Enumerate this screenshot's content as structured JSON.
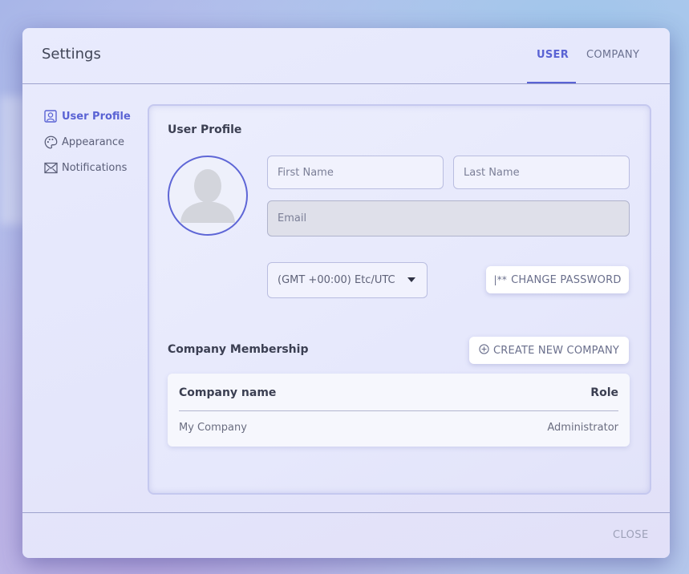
{
  "dialog": {
    "title": "Settings",
    "tabs": [
      {
        "label": "USER",
        "active": true
      },
      {
        "label": "COMPANY",
        "active": false
      }
    ],
    "close_label": "CLOSE"
  },
  "sidebar": {
    "items": [
      {
        "label": "User Profile",
        "icon": "user-portrait-icon",
        "active": true
      },
      {
        "label": "Appearance",
        "icon": "palette-icon",
        "active": false
      },
      {
        "label": "Notifications",
        "icon": "envelope-icon",
        "active": false
      }
    ]
  },
  "profile": {
    "section_title": "User Profile",
    "first_name": {
      "value": "",
      "placeholder": "First Name"
    },
    "last_name": {
      "value": "",
      "placeholder": "Last Name"
    },
    "email": {
      "value": "",
      "placeholder": "Email",
      "disabled": true
    },
    "timezone": {
      "selected": "(GMT +00:00) Etc/UTC"
    },
    "change_password_icon": "|**",
    "change_password_label": "CHANGE PASSWORD"
  },
  "membership": {
    "section_title": "Company Membership",
    "create_button_label": "CREATE NEW COMPANY",
    "create_button_icon": "plus-circle-icon",
    "columns": [
      "Company name",
      "Role"
    ],
    "rows": [
      {
        "company": "My Company",
        "role": "Administrator"
      }
    ]
  },
  "colors": {
    "accent": "#5a63d4",
    "text_primary": "#3b3f52",
    "text_muted": "#6a6f8c"
  }
}
